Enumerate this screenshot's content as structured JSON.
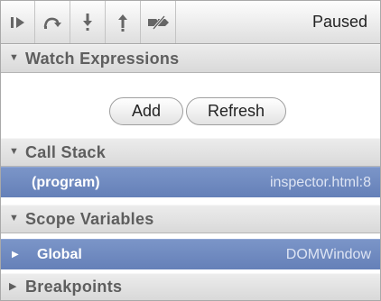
{
  "toolbar": {
    "buttons": [
      {
        "icon": "continue-icon"
      },
      {
        "icon": "step-over-icon"
      },
      {
        "icon": "step-into-icon"
      },
      {
        "icon": "step-out-icon"
      },
      {
        "icon": "deactivate-breakpoints-icon"
      }
    ],
    "status": "Paused"
  },
  "watch": {
    "header": "Watch Expressions",
    "add_label": "Add",
    "refresh_label": "Refresh"
  },
  "call_stack": {
    "header": "Call Stack",
    "frames": [
      {
        "name": "(program)",
        "location": "inspector.html:8"
      }
    ]
  },
  "scope": {
    "header": "Scope Variables",
    "items": [
      {
        "name": "Global",
        "value": "DOMWindow"
      }
    ]
  },
  "breakpoints": {
    "header": "Breakpoints"
  },
  "colors": {
    "selection": "#6f89bf",
    "header_text": "#5e5e5e"
  }
}
